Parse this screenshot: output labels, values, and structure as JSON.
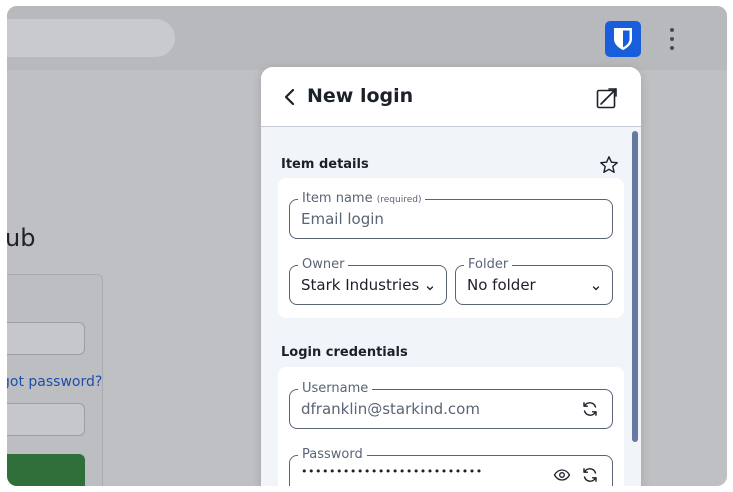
{
  "background_page": {
    "title_fragment": "ub",
    "forgot_link_fragment": "got password?"
  },
  "toolbar": {
    "extension_icon": "bitwarden-shield-icon",
    "menu_icon": "kebab-menu-icon"
  },
  "popup": {
    "title": "New login",
    "back_icon": "chevron-left-icon",
    "popout_icon": "popout-icon",
    "item_details": {
      "heading": "Item details",
      "favorite_icon": "star-icon",
      "item_name": {
        "label": "Item name",
        "required_hint": "(required)",
        "placeholder": "Email login"
      },
      "owner": {
        "label": "Owner",
        "value": "Stark Industries"
      },
      "folder": {
        "label": "Folder",
        "value": "No folder"
      }
    },
    "login_credentials": {
      "heading": "Login credentials",
      "username": {
        "label": "Username",
        "value": "dfranklin@starkind.com"
      },
      "password": {
        "label": "Password",
        "value": "••••••••••••••••••••••••••"
      }
    }
  },
  "colors": {
    "brand": "#175ddc",
    "overlay": "#bfc0c3",
    "panel_background": "#f1f4f8",
    "border": "#5a6475",
    "text": "#1b2029"
  }
}
